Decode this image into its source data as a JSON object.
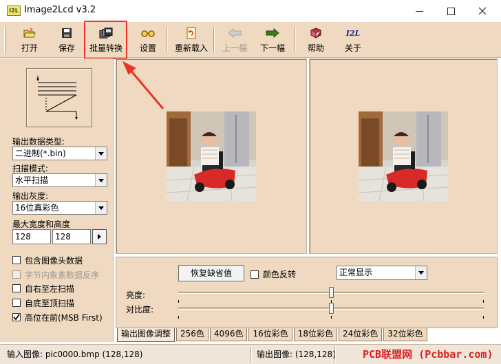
{
  "window": {
    "icon_text": "I2L",
    "title": "Image2Lcd v3.2"
  },
  "toolbar": {
    "items": [
      {
        "label": "打开",
        "icon": "open-folder-icon"
      },
      {
        "label": "保存",
        "icon": "floppy-disk-icon"
      },
      {
        "label": "批量转换",
        "icon": "batch-convert-icon"
      },
      {
        "label": "设置",
        "icon": "glasses-icon"
      },
      {
        "label": "重新载入",
        "icon": "reload-icon"
      },
      {
        "label": "上一幅",
        "icon": "arrow-left-icon",
        "disabled": true
      },
      {
        "label": "下一幅",
        "icon": "arrow-right-icon"
      },
      {
        "label": "帮助",
        "icon": "help-book-icon"
      },
      {
        "label": "关于",
        "icon": "i2l-logo-icon"
      }
    ]
  },
  "left_panel": {
    "output_type_label": "输出数据类型:",
    "output_type_value": "二进制(*.bin)",
    "scan_mode_label": "扫描模式:",
    "scan_mode_value": "水平扫描",
    "gray_label": "输出灰度:",
    "gray_value": "16位真彩色",
    "max_size_label": "最大宽度和高度",
    "max_width": "128",
    "max_height": "128",
    "checkboxes": [
      {
        "label": "包含图像头数据",
        "checked": false,
        "disabled": false
      },
      {
        "label": "字节内象素数据反序",
        "checked": false,
        "disabled": true
      },
      {
        "label": "自右至左扫描",
        "checked": false,
        "disabled": false
      },
      {
        "label": "自底至顶扫描",
        "checked": false,
        "disabled": false
      },
      {
        "label": "高位在前(MSB First)",
        "checked": true,
        "disabled": false
      }
    ]
  },
  "controls": {
    "reset_button": "恢复缺省值",
    "invert_label": "颜色反转",
    "display_mode": "正常显示",
    "brightness_label": "亮度:",
    "contrast_label": "对比度:",
    "brightness_level": 0.5,
    "contrast_level": 0.5
  },
  "tabs": [
    "输出图像调整",
    "256色",
    "4096色",
    "16位彩色",
    "18位彩色",
    "24位彩色",
    "32位彩色"
  ],
  "status": {
    "input_image": "输入图像:  pic0000.bmp (128,128)",
    "output_image": "输出图像:  (128,128)"
  },
  "watermark": "PCB联盟网 (Pcbbar.com)",
  "colors": {
    "panel_bg": "#efd9c0",
    "highlight": "#e8322a"
  }
}
